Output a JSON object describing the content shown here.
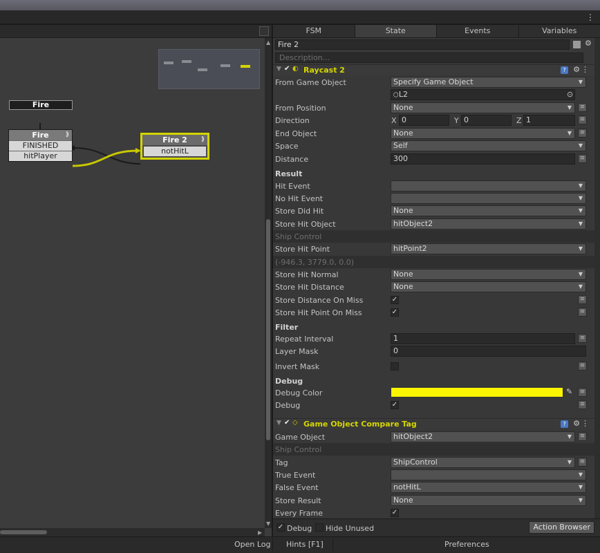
{
  "graph": {
    "state_label": "Fire",
    "nodes": {
      "fire": {
        "title": "Fire",
        "events": [
          "FINISHED",
          "hitPlayer"
        ]
      },
      "fire2": {
        "title": "Fire 2",
        "events": [
          "notHitL"
        ]
      }
    }
  },
  "tabs": [
    "FSM",
    "State",
    "Events",
    "Variables"
  ],
  "active_tab": "State",
  "state": {
    "name": "Fire 2",
    "description_placeholder": "Description..."
  },
  "raycast": {
    "title": "Raycast 2",
    "rows": {
      "from_game_object": {
        "label": "From Game Object",
        "value": "Specify Game Object"
      },
      "game_object": {
        "value": "L2"
      },
      "from_position": {
        "label": "From Position",
        "value": "None"
      },
      "direction": {
        "label": "Direction",
        "x_label": "X",
        "x": "0",
        "y_label": "Y",
        "y": "0",
        "z_label": "Z",
        "z": "1"
      },
      "end_object": {
        "label": "End Object",
        "value": "None"
      },
      "space": {
        "label": "Space",
        "value": "Self"
      },
      "distance": {
        "label": "Distance",
        "value": "300"
      },
      "result": {
        "label": "Result"
      },
      "hit_event": {
        "label": "Hit Event",
        "value": ""
      },
      "no_hit_event": {
        "label": "No Hit Event",
        "value": ""
      },
      "store_did_hit": {
        "label": "Store Did Hit",
        "value": "None"
      },
      "store_hit_object": {
        "label": "Store Hit Object",
        "value": "hitObject2"
      },
      "ship_control": {
        "label": "Ship Control"
      },
      "store_hit_point": {
        "label": "Store Hit Point",
        "value": "hitPoint2"
      },
      "hit_point_readout": {
        "label": "(-946.3, 3779.0, 0.0)"
      },
      "store_hit_normal": {
        "label": "Store Hit Normal",
        "value": "None"
      },
      "store_hit_distance": {
        "label": "Store Hit Distance",
        "value": "None"
      },
      "store_distance_on_miss": {
        "label": "Store Distance On Miss",
        "checked": "✓"
      },
      "store_hit_point_on_miss": {
        "label": "Store Hit Point On Miss",
        "checked": "✓"
      },
      "filter": {
        "label": "Filter"
      },
      "repeat_interval": {
        "label": "Repeat Interval",
        "value": "1"
      },
      "layer_mask": {
        "label": "Layer Mask",
        "value": "0"
      },
      "invert_mask": {
        "label": "Invert Mask",
        "checked": ""
      },
      "debug_header": {
        "label": "Debug"
      },
      "debug_color": {
        "label": "Debug Color",
        "color": "#fbf600"
      },
      "debug": {
        "label": "Debug",
        "checked": "✓"
      }
    }
  },
  "compare_tag": {
    "title": "Game Object Compare Tag",
    "rows": {
      "game_object": {
        "label": "Game Object",
        "value": "hitObject2"
      },
      "ship_control": {
        "label": "Ship Control"
      },
      "tag": {
        "label": "Tag",
        "value": "ShipControl"
      },
      "true_event": {
        "label": "True Event",
        "value": ""
      },
      "false_event": {
        "label": "False Event",
        "value": "notHitL"
      },
      "store_result": {
        "label": "Store Result",
        "value": "None"
      },
      "every_frame": {
        "label": "Every Frame",
        "checked": "✓"
      }
    }
  },
  "bottom": {
    "debug_label": "Debug",
    "debug_checked": "✓",
    "hide_unused_label": "Hide Unused",
    "action_browser": "Action Browser"
  },
  "footer": {
    "open_log": "Open Log",
    "hints": "Hints [F1]",
    "preferences": "Preferences"
  },
  "colors": {
    "accent": "#d4d400",
    "debug_color": "#fbf600"
  }
}
